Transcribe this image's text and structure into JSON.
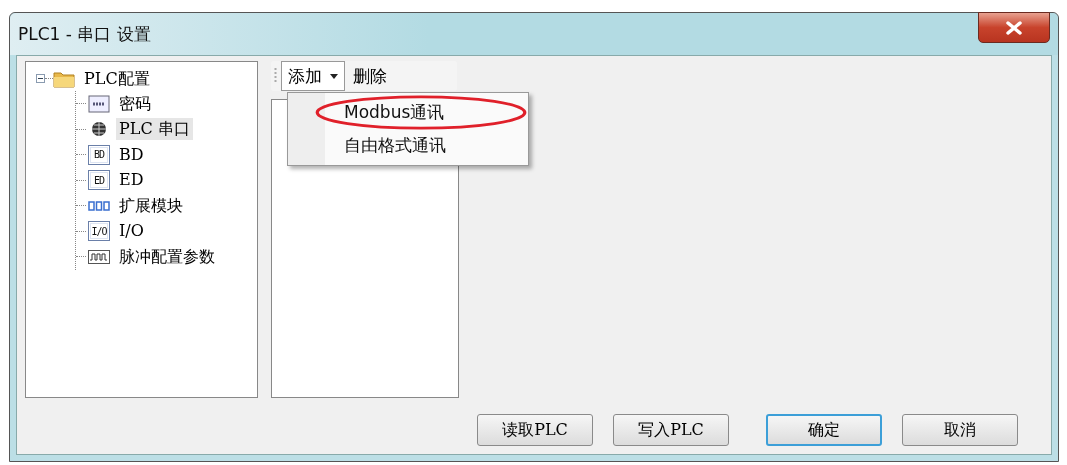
{
  "window": {
    "title": "PLC1 - 串口  设置"
  },
  "tree": {
    "label": "PLC配置",
    "expanded": true,
    "children": [
      {
        "label": "密码",
        "kind": "password",
        "selected": false
      },
      {
        "label": "PLC 串口",
        "kind": "serial",
        "selected": true
      },
      {
        "label": "BD",
        "kind": "bd",
        "icon_text": "BD",
        "selected": false
      },
      {
        "label": "ED",
        "kind": "ed",
        "icon_text": "ED",
        "selected": false
      },
      {
        "label": "扩展模块",
        "kind": "module",
        "selected": false
      },
      {
        "label": "I/O",
        "kind": "io",
        "icon_text": "I/O",
        "selected": false
      },
      {
        "label": "脉冲配置参数",
        "kind": "pulse",
        "selected": false
      }
    ]
  },
  "toolbar": {
    "add": "添加",
    "delete": "删除"
  },
  "menu": [
    {
      "label": "Modbus通讯",
      "circled": true
    },
    {
      "label": "自由格式通讯",
      "circled": false
    }
  ],
  "buttons": [
    {
      "label": "读取PLC",
      "default": false
    },
    {
      "label": "写入PLC",
      "default": false
    },
    {
      "label": "确定",
      "default": true
    },
    {
      "label": "取消",
      "default": false
    }
  ]
}
